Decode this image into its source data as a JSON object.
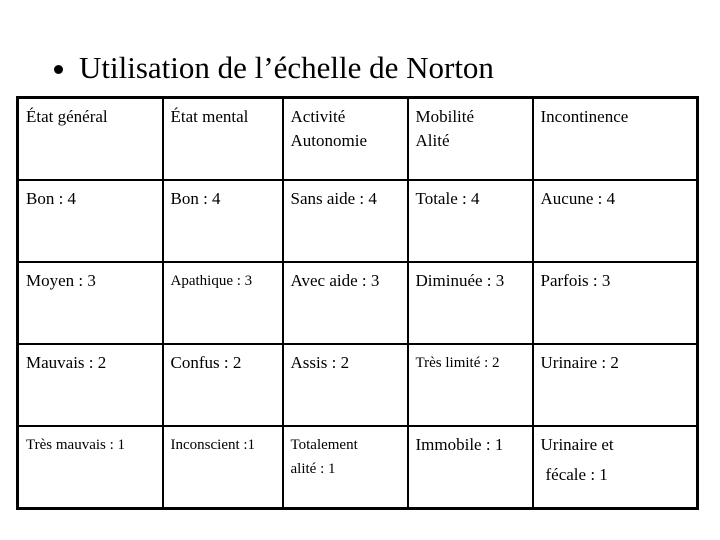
{
  "slide": {
    "title": "Utilisation de l’échelle de Norton",
    "bullet_icon": "bullet-icon"
  },
  "table": {
    "headers": [
      {
        "line1": "État général",
        "line2": ""
      },
      {
        "line1": "État mental",
        "line2": ""
      },
      {
        "line1": "Activité",
        "line2": "Autonomie"
      },
      {
        "line1": "Mobilité",
        "line2": "Alité"
      },
      {
        "line1": "Incontinence",
        "line2": ""
      }
    ],
    "rows": [
      [
        {
          "line1": "Bon : 4",
          "line2": ""
        },
        {
          "line1": "Bon : 4",
          "line2": ""
        },
        {
          "line1": "Sans aide : 4",
          "line2": ""
        },
        {
          "line1": "Totale : 4",
          "line2": ""
        },
        {
          "line1": "Aucune : 4",
          "line2": ""
        }
      ],
      [
        {
          "line1": "Moyen : 3",
          "line2": ""
        },
        {
          "line1": "Apathique : 3",
          "line2": ""
        },
        {
          "line1": "Avec aide : 3",
          "line2": ""
        },
        {
          "line1": "Diminuée : 3",
          "line2": ""
        },
        {
          "line1": "Parfois : 3",
          "line2": ""
        }
      ],
      [
        {
          "line1": "Mauvais : 2",
          "line2": ""
        },
        {
          "line1": "Confus : 2",
          "line2": ""
        },
        {
          "line1": "Assis : 2",
          "line2": ""
        },
        {
          "line1": "Très limité : 2",
          "line2": ""
        },
        {
          "line1": "Urinaire : 2",
          "line2": ""
        }
      ],
      [
        {
          "line1": "Très mauvais : 1",
          "line2": ""
        },
        {
          "line1": "Inconscient :1",
          "line2": ""
        },
        {
          "line1": "Totalement",
          "line2": "alité : 1"
        },
        {
          "line1": "Immobile : 1",
          "line2": ""
        },
        {
          "line1": "Urinaire et",
          "line2": "fécale : 1"
        }
      ]
    ]
  }
}
